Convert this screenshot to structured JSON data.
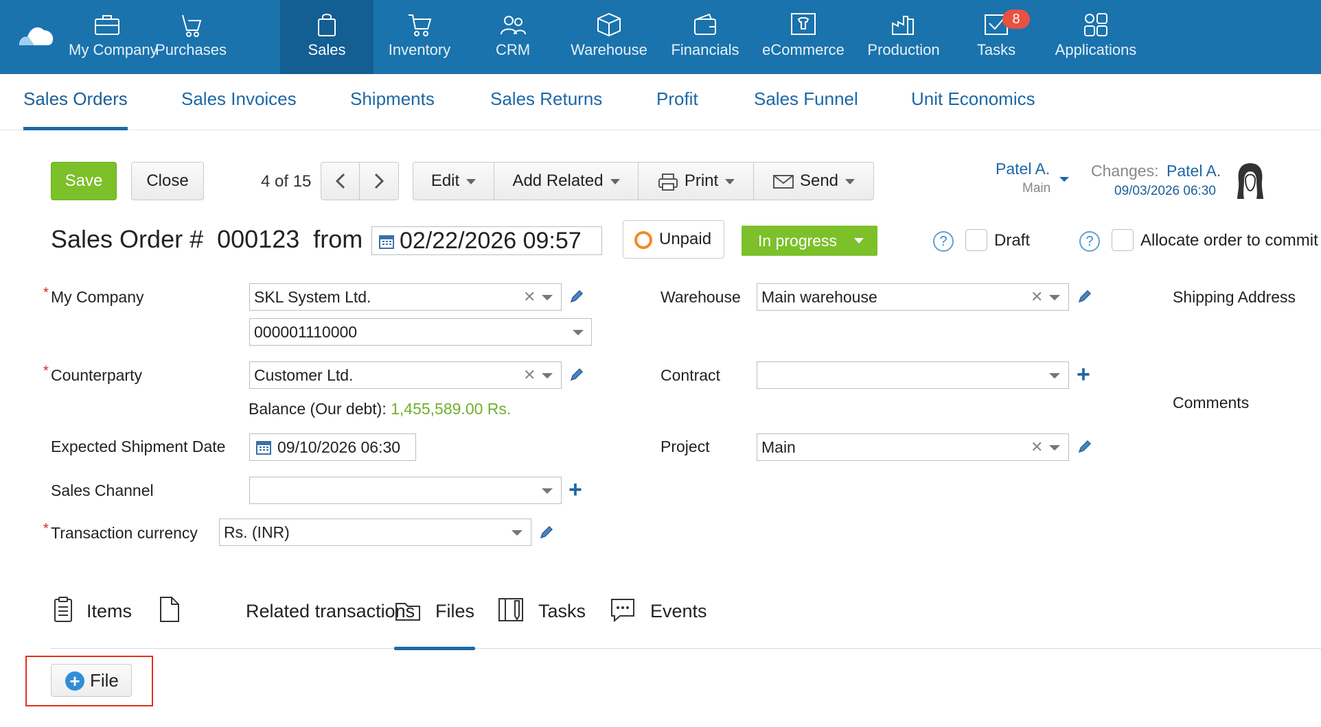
{
  "topnav": {
    "items": [
      {
        "label": "My Company",
        "icon": "briefcase-icon"
      },
      {
        "label": "Purchases",
        "icon": "cart-hand-icon"
      },
      {
        "label": "Sales",
        "icon": "shopping-bag-icon"
      },
      {
        "label": "Inventory",
        "icon": "cart-icon"
      },
      {
        "label": "CRM",
        "icon": "people-icon"
      },
      {
        "label": "Warehouse",
        "icon": "box-icon"
      },
      {
        "label": "Financials",
        "icon": "wallet-icon"
      },
      {
        "label": "eCommerce",
        "icon": "shirt-screen-icon"
      },
      {
        "label": "Production",
        "icon": "factory-icon"
      },
      {
        "label": "Tasks",
        "icon": "checkbox-mail-icon",
        "badge": "8"
      },
      {
        "label": "Applications",
        "icon": "apps-grid-icon"
      }
    ],
    "active": "Sales"
  },
  "subnav": {
    "tabs": [
      "Sales Orders",
      "Sales Invoices",
      "Shipments",
      "Sales Returns",
      "Profit",
      "Sales Funnel",
      "Unit Economics"
    ],
    "active": "Sales Orders"
  },
  "toolbar": {
    "save": "Save",
    "close": "Close",
    "pager": "4 of 15",
    "edit": "Edit",
    "add_related": "Add Related",
    "print": "Print",
    "send": "Send"
  },
  "header_right": {
    "owner": "Patel A.",
    "owner_sub": "Main",
    "changes_label": "Changes:",
    "changes_user": "Patel A.",
    "changes_date": "09/03/2026 06:30"
  },
  "order": {
    "title_prefix": "Sales Order #",
    "number": "000123",
    "from_label": "from",
    "date": "02/22/2026 09:57",
    "payment_status": "Unpaid",
    "status": "In progress",
    "draft_label": "Draft",
    "allocate_label": "Allocate order to commit"
  },
  "form": {
    "my_company_label": "My Company",
    "my_company_value": "SKL System Ltd.",
    "account_value": "000001110000",
    "counterparty_label": "Counterparty",
    "counterparty_value": "Customer Ltd.",
    "balance_label": "Balance (Our debt):",
    "balance_value": "1,455,589.00 Rs.",
    "expected_shipment_label": "Expected Shipment Date",
    "expected_shipment_value": "09/10/2026 06:30",
    "sales_channel_label": "Sales Channel",
    "sales_channel_value": "",
    "currency_label": "Transaction currency",
    "currency_value": "Rs. (INR)",
    "warehouse_label": "Warehouse",
    "warehouse_value": "Main warehouse",
    "contract_label": "Contract",
    "contract_value": "",
    "project_label": "Project",
    "project_value": "Main",
    "shipping_label": "Shipping Address",
    "comments_label": "Comments"
  },
  "bottom_tabs": {
    "items": [
      "Items",
      "Related transactions",
      "Files",
      "Tasks",
      "Events"
    ],
    "active": "Files"
  },
  "files": {
    "add_button": "File"
  },
  "colors": {
    "nav_bg": "#1a73ad",
    "nav_active": "#135e92",
    "save_green": "#7cc02a",
    "link_blue": "#1c67a6",
    "badge_red": "#e8523f",
    "highlight_red": "#e0301e"
  }
}
